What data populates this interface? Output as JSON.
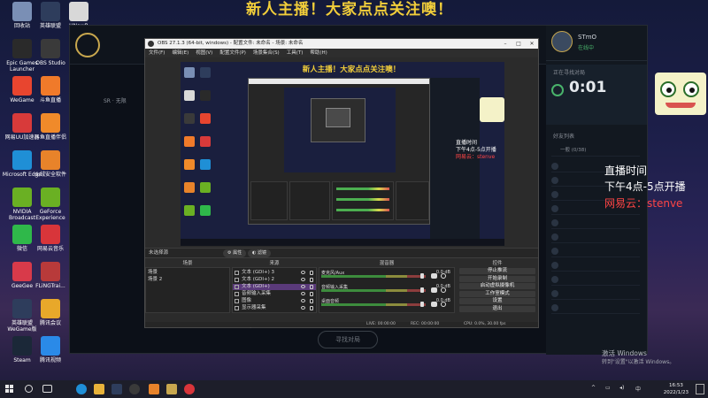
{
  "desktop": {
    "banner": "新人主播！大家点点关注噢！",
    "icons": [
      {
        "label": "回收站",
        "color": "#7a8fb5"
      },
      {
        "label": "英雄联盟",
        "color": "#2e3d5c"
      },
      {
        "label": "UNewR",
        "color": "#d8d8d8"
      },
      {
        "label": "Epic Games Launcher",
        "color": "#2a2a2a"
      },
      {
        "label": "OBS Studio",
        "color": "#3a3a3a"
      },
      {
        "label": "WeGame",
        "color": "#e8452f"
      },
      {
        "label": "斗鱼直播",
        "color": "#f07a2a"
      },
      {
        "label": "网易UU加速器",
        "color": "#d83a3a"
      },
      {
        "label": "斗鱼直播伴侣",
        "color": "#f08a2a"
      },
      {
        "label": "Microsoft Edge",
        "color": "#1f8fd6"
      },
      {
        "label": "火绒安全软件",
        "color": "#e8832a"
      },
      {
        "label": "NVIDIA Broadcast",
        "color": "#6ab023"
      },
      {
        "label": "GeForce Experience",
        "color": "#6ab023"
      },
      {
        "label": "微信",
        "color": "#2fb84a"
      },
      {
        "label": "网易云音乐",
        "color": "#d8353a"
      },
      {
        "label": "GeeGee",
        "color": "#d83a4a"
      },
      {
        "label": "FLiNGTrai...",
        "color": "#b83a3a"
      },
      {
        "label": "英雄联盟WeGame版",
        "color": "#2e3d5c"
      },
      {
        "label": "腾讯会议",
        "color": "#e8a82a"
      },
      {
        "label": "Steam",
        "color": "#1b2838"
      },
      {
        "label": "腾讯视频",
        "color": "#2a8ae8"
      }
    ]
  },
  "game_client": {
    "subtitle": "SR · 无限",
    "profile_name": "STmO",
    "profile_status": "在线中",
    "timer_label": "正在寻找对局",
    "timer": "0:01",
    "friends_label": "好友列表",
    "friends_group": "一般 (0/38)",
    "play_button": "寻找对局"
  },
  "overlay": {
    "line1": "直播时间",
    "line2": "下午4点-5点开播",
    "line3": "网易云：stenve"
  },
  "obs": {
    "title": "OBS 27.1.3 (64-bit, windows) - 配置文件: 未命名 - 场景: 未命名",
    "menu": [
      "文件(F)",
      "编辑(E)",
      "视图(V)",
      "配置文件(P)",
      "场景集合(S)",
      "工具(T)",
      "帮助(H)"
    ],
    "source_toolbar": {
      "label": "未选择源",
      "properties": "属性",
      "filters": "滤镜"
    },
    "docks": {
      "scenes": "场景",
      "sources": "来源",
      "mixer": "混音器",
      "controls": "控件"
    },
    "scenes": [
      "场景",
      "场景 2"
    ],
    "sources": [
      {
        "name": "文本 (GDI+) 3",
        "selected": false
      },
      {
        "name": "文本 (GDI+) 2",
        "selected": false
      },
      {
        "name": "文本 (GDI+)",
        "selected": true
      },
      {
        "name": "音频输入采集",
        "selected": false
      },
      {
        "name": "图像",
        "selected": false
      },
      {
        "name": "显示器采集",
        "selected": false
      }
    ],
    "mixer": [
      {
        "name": "麦克风/Aux",
        "db": "0.0 dB",
        "level": 0.95
      },
      {
        "name": "音频输入采集",
        "db": "0.0 dB",
        "level": 0.95
      },
      {
        "name": "桌面音频",
        "db": "0.0 dB",
        "level": 0.95
      }
    ],
    "controls": [
      "停止推流",
      "开始录制",
      "启动虚拟摄像机",
      "工作室模式",
      "设置",
      "退出"
    ],
    "status": {
      "live": "LIVE: 00:00:00",
      "rec": "REC: 00:00:00",
      "cpu": "CPU: 0.0%, 30.00 fps"
    },
    "preview": {
      "banner": "新人主播！大家点点关注噢！",
      "text1": "直播时间",
      "text2": "下午4点-5点开播",
      "text3": "网易云：stenve"
    }
  },
  "windows": {
    "activation_title": "激活 Windows",
    "activation_sub": "转到\"设置\"以激活 Windows。",
    "time": "16:53",
    "date": "2022/1/23",
    "ime": "中"
  },
  "colors": {
    "banner": "#f2ce3a",
    "selection": "#5a3a7a",
    "overlay_red": "#ff4545"
  }
}
